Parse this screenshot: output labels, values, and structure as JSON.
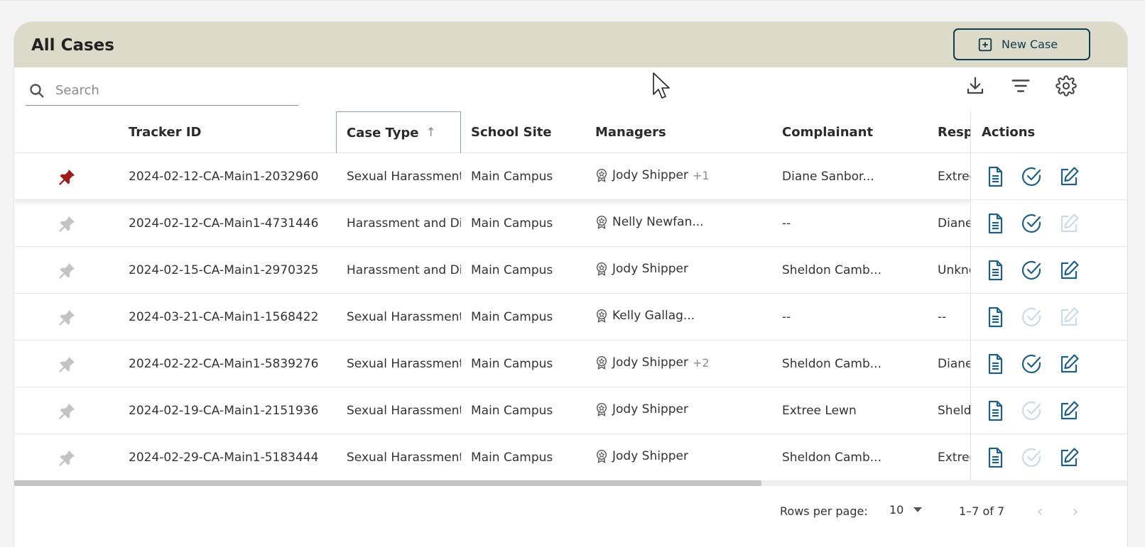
{
  "header": {
    "title": "All Cases",
    "new_case_label": "New Case"
  },
  "search": {
    "placeholder": "Search"
  },
  "toolbar": {
    "icons": [
      "download-icon",
      "filter-icon",
      "gear-icon"
    ]
  },
  "columns": {
    "tracker_id": "Tracker ID",
    "case_type": "Case Type",
    "school_site": "School Site",
    "managers": "Managers",
    "complainant": "Complainant",
    "respondent": "Resp",
    "actions": "Actions"
  },
  "sort": {
    "column": "Case Type",
    "direction": "ascending"
  },
  "rows": [
    {
      "pinned": true,
      "tracker_id": "2024-02-12-CA-Main1-2032960",
      "case_type": "Sexual Harassment",
      "school_site": "Main Campus",
      "manager": "Jody Shipper",
      "manager_extra": "+1",
      "complainant": "Diane Sanbor...",
      "respondent": "Extree",
      "doc_enabled": true,
      "check_enabled": true,
      "edit_enabled": true
    },
    {
      "pinned": false,
      "tracker_id": "2024-02-12-CA-Main1-4731446",
      "case_type": "Harassment and Dis",
      "school_site": "Main Campus",
      "manager": "Nelly Newfan...",
      "manager_extra": "",
      "complainant": "--",
      "respondent": "Diane",
      "doc_enabled": true,
      "check_enabled": true,
      "edit_enabled": false
    },
    {
      "pinned": false,
      "tracker_id": "2024-02-15-CA-Main1-2970325",
      "case_type": "Harassment and Dis",
      "school_site": "Main Campus",
      "manager": "Jody Shipper",
      "manager_extra": "",
      "complainant": "Sheldon Camb...",
      "respondent": "Unkno",
      "doc_enabled": true,
      "check_enabled": true,
      "edit_enabled": true
    },
    {
      "pinned": false,
      "tracker_id": "2024-03-21-CA-Main1-1568422",
      "case_type": "Sexual Harassment",
      "school_site": "Main Campus",
      "manager": "Kelly Gallag...",
      "manager_extra": "",
      "complainant": "--",
      "respondent": "--",
      "doc_enabled": true,
      "check_enabled": false,
      "edit_enabled": false
    },
    {
      "pinned": false,
      "tracker_id": "2024-02-22-CA-Main1-5839276",
      "case_type": "Sexual Harassment",
      "school_site": "Main Campus",
      "manager": "Jody Shipper",
      "manager_extra": "+2",
      "complainant": "Sheldon Camb...",
      "respondent": "Diane",
      "doc_enabled": true,
      "check_enabled": true,
      "edit_enabled": true
    },
    {
      "pinned": false,
      "tracker_id": "2024-02-19-CA-Main1-2151936",
      "case_type": "Sexual Harassment",
      "school_site": "Main Campus",
      "manager": "Jody Shipper",
      "manager_extra": "",
      "complainant": "Extree Lewn",
      "respondent": "Sheld",
      "doc_enabled": true,
      "check_enabled": false,
      "edit_enabled": true
    },
    {
      "pinned": false,
      "tracker_id": "2024-02-29-CA-Main1-5183444",
      "case_type": "Sexual Harassment",
      "school_site": "Main Campus",
      "manager": "Jody Shipper",
      "manager_extra": "",
      "complainant": "Sheldon Camb...",
      "respondent": "Extree",
      "doc_enabled": true,
      "check_enabled": false,
      "edit_enabled": true
    }
  ],
  "pagination": {
    "rows_per_page_label": "Rows per page:",
    "rows_per_page": "10",
    "range": "1–7 of 7",
    "prev_enabled": false,
    "next_enabled": false
  },
  "colors": {
    "header_bg": "#dcdbca",
    "primary": "#14394b",
    "action_teal": "#1f5f84",
    "action_disabled": "#c9dbe6",
    "pin_active": "#9b1d1d",
    "pin_inactive": "#c3c3c3"
  }
}
